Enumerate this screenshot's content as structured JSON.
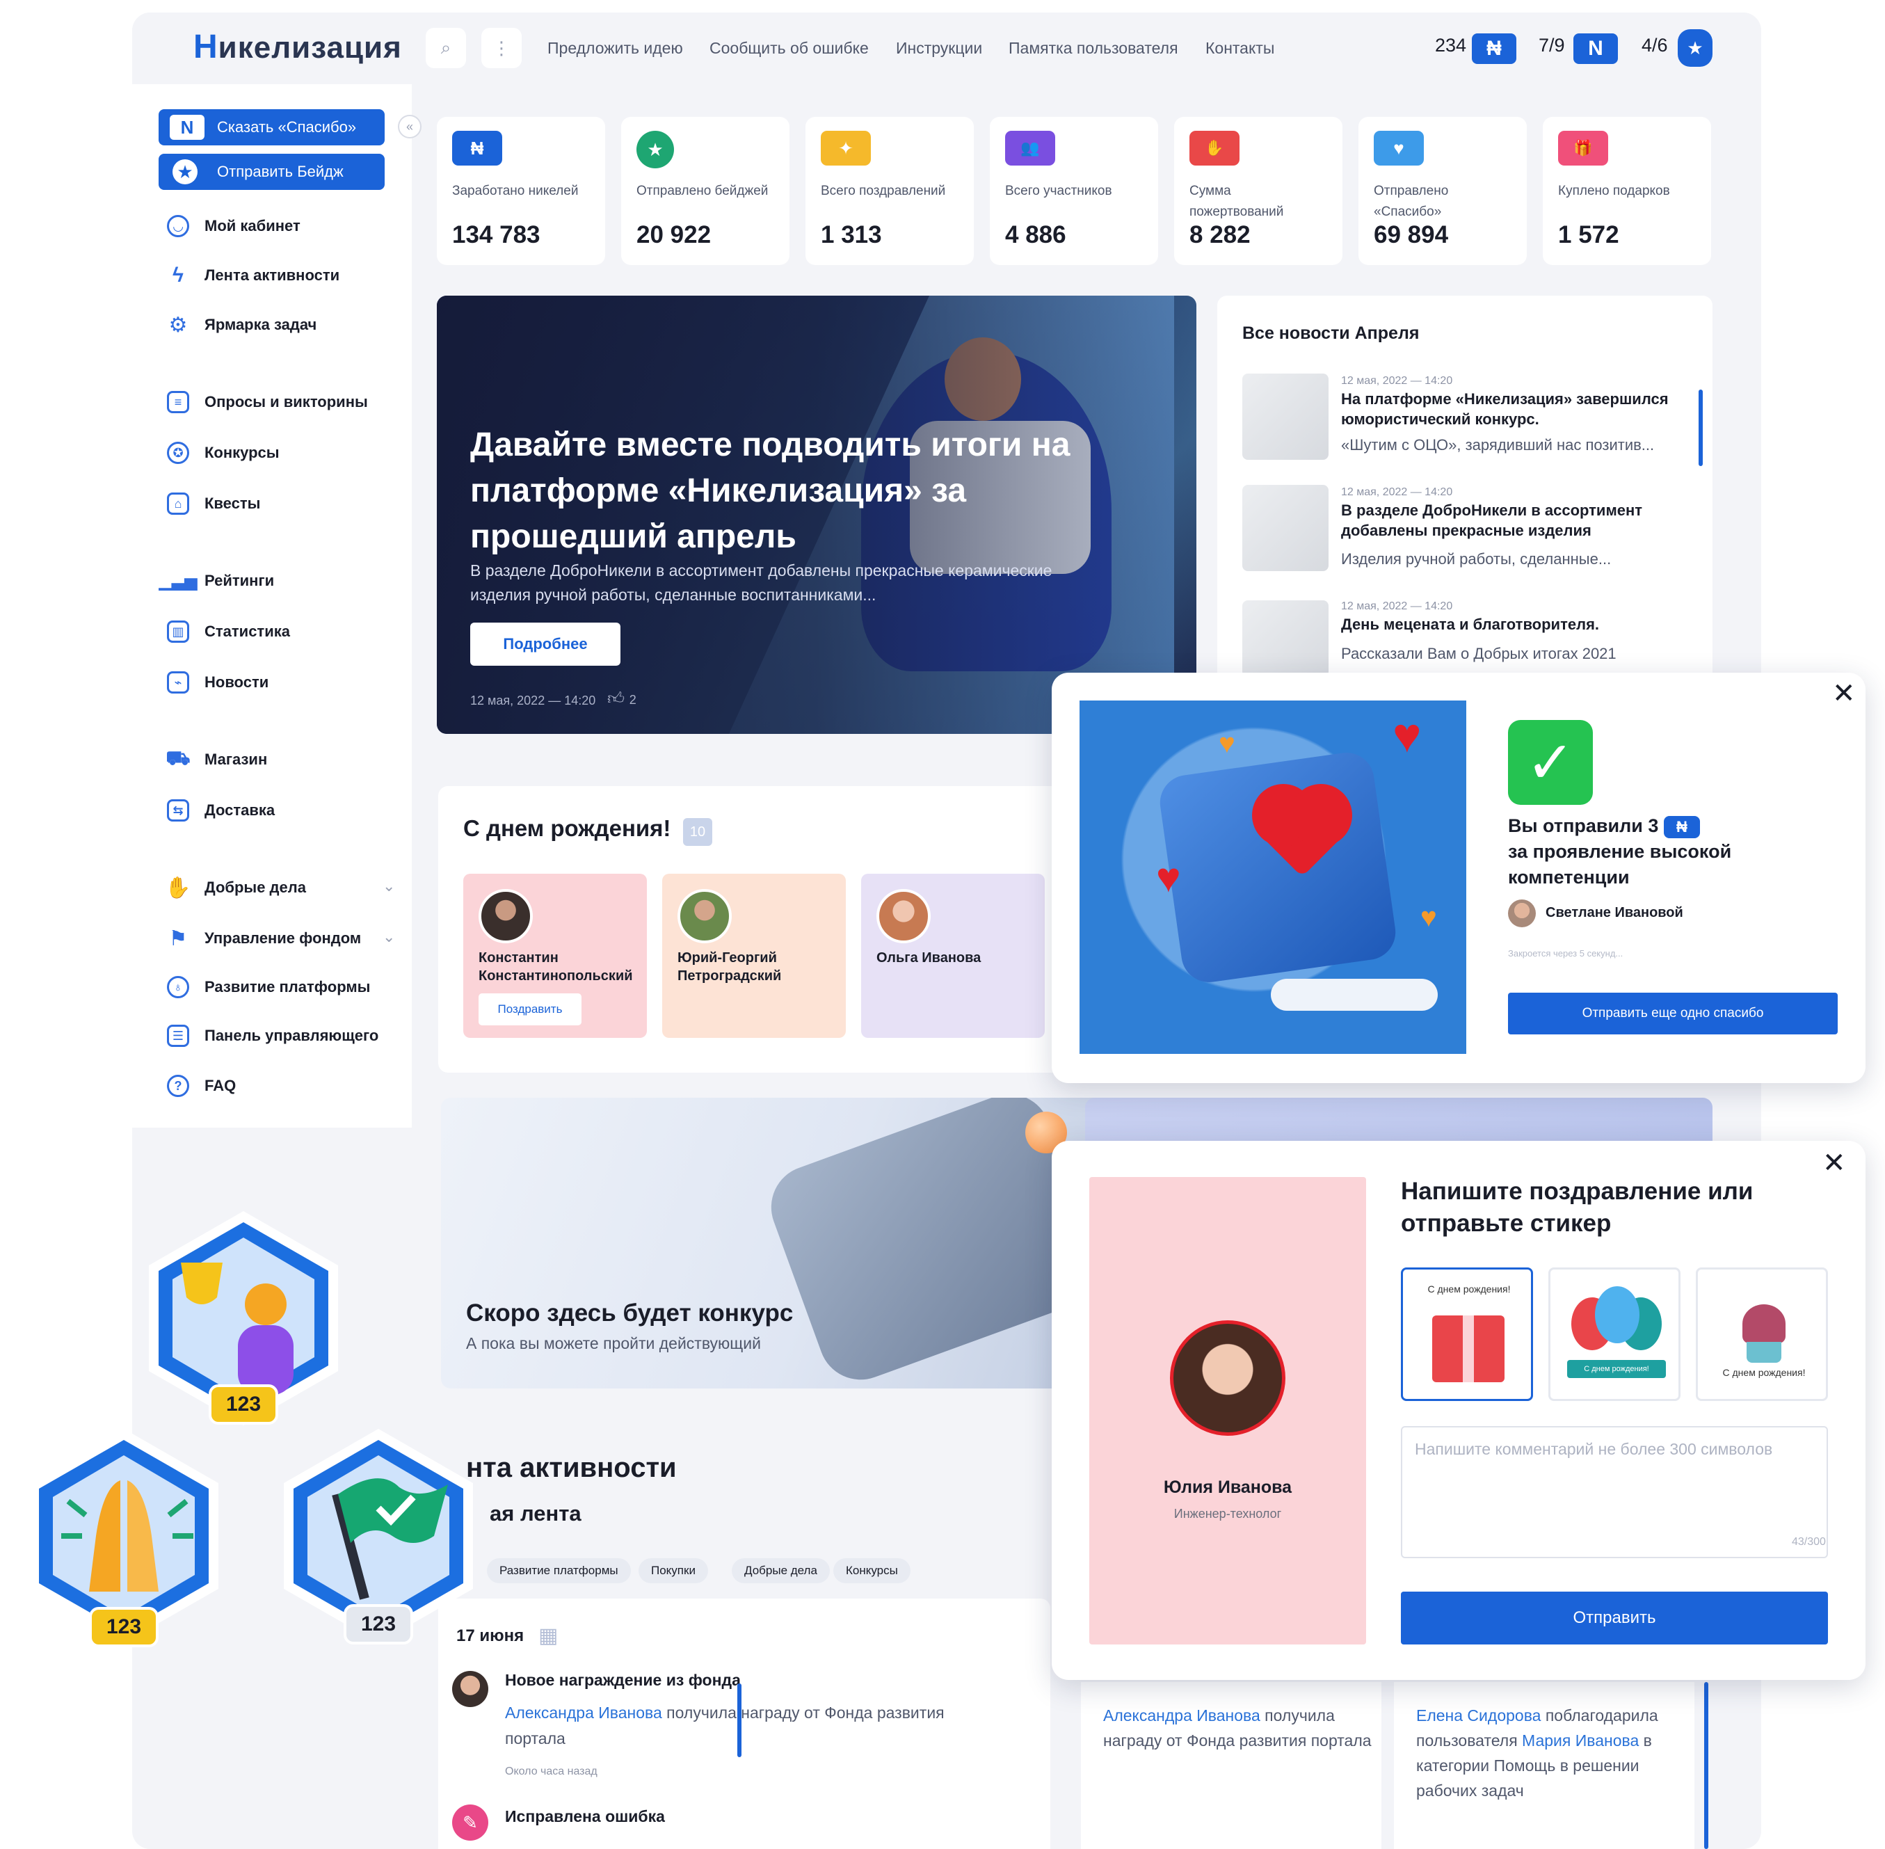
{
  "header": {
    "logo_first": "Н",
    "logo_rest": "икелизация",
    "nav": [
      "Предложить идею",
      "Сообщить об ошибке",
      "Инструкции",
      "Памятка пользователя",
      "Контакты"
    ],
    "counters": [
      {
        "value": "234",
        "icon": "nickel-icon"
      },
      {
        "value": "7/9",
        "icon": "nickel-heart-icon"
      },
      {
        "value": "4/6",
        "icon": "badge-star-icon"
      }
    ]
  },
  "sidebar": {
    "primary_buttons": [
      "Сказать «Спасибо»",
      "Отправить Бейдж"
    ],
    "items": [
      {
        "label": "Мой кабинет",
        "icon": "user-icon"
      },
      {
        "label": "Лента активности",
        "icon": "lightning-icon"
      },
      {
        "label": "Ярмарка задач",
        "icon": "gear-icon"
      },
      {
        "label": "Опросы и викторины",
        "icon": "poll-icon"
      },
      {
        "label": "Конкурсы",
        "icon": "award-icon"
      },
      {
        "label": "Квесты",
        "icon": "quest-icon"
      },
      {
        "label": "Рейтинги",
        "icon": "rating-icon"
      },
      {
        "label": "Статистика",
        "icon": "chart-icon"
      },
      {
        "label": "Новости",
        "icon": "news-icon"
      },
      {
        "label": "Магазин",
        "icon": "cart-icon"
      },
      {
        "label": "Доставка",
        "icon": "delivery-icon"
      },
      {
        "label": "Добрые дела",
        "icon": "hand-heart-icon"
      },
      {
        "label": "Управление фондом",
        "icon": "flag-icon"
      },
      {
        "label": "Развитие платформы",
        "icon": "bulb-icon"
      },
      {
        "label": "Панель управляющего",
        "icon": "panel-icon"
      },
      {
        "label": "FAQ",
        "icon": "question-icon"
      }
    ]
  },
  "stats": [
    {
      "label": "Заработано никелей",
      "value": "134 783",
      "color": "#1b63d8",
      "glyph": "₦"
    },
    {
      "label": "Отправлено бейджей",
      "value": "20 922",
      "color": "#1ea672",
      "glyph": "★"
    },
    {
      "label": "Всего поздравлений",
      "value": "1 313",
      "color": "#f5b92b",
      "glyph": "✦"
    },
    {
      "label": "Всего участников",
      "value": "4 886",
      "color": "#7a4fe0",
      "glyph": "👥"
    },
    {
      "label": "Сумма пожертвований",
      "value": "8 282",
      "color": "#e94848",
      "glyph": "✋"
    },
    {
      "label": "Отправлено «Спасибо»",
      "value": "69 894",
      "color": "#3d9be9",
      "glyph": "♥"
    },
    {
      "label": "Куплено подарков",
      "value": "1 572",
      "color": "#f0507a",
      "glyph": "🎁"
    }
  ],
  "hero": {
    "title": "Давайте вместе подводить итоги на платформе «Никелизация» за прошедший апрель",
    "subtitle": "В разделе ДоброНикели в ассортимент добавлены прекрасные керамические изделия ручной работы, сделанные воспитанниками...",
    "button": "Подробнее",
    "date": "12 мая, 2022 — 14:20",
    "likes": "2"
  },
  "news": {
    "title": "Все новости Апреля",
    "items": [
      {
        "date": "12 мая, 2022 — 14:20",
        "title": "На платформе «Никелизация» завершился юмористический конкурс.",
        "text": "«Шутим с ОЦО», зарядивший нас позитив..."
      },
      {
        "date": "12 мая, 2022 — 14:20",
        "title": "В разделе ДоброНикели в ассортимент добавлены прекрасные изделия",
        "text": "Изделия ручной работы, сделанные..."
      },
      {
        "date": "12 мая, 2022 — 14:20",
        "title": "День мецената и благотворителя.",
        "text": "Рассказали Вам о Добрых итогах 2021"
      }
    ]
  },
  "birthdays": {
    "title": "С днем рождения!",
    "count": "10",
    "people": [
      {
        "name": "Константин Константинопольский",
        "action": "Поздравить",
        "bg": "#fbd4d8"
      },
      {
        "name": "Юрий-Георгий Петроградский",
        "bg": "#fde3d5"
      },
      {
        "name": "Ольга Иванова",
        "bg": "#e7e1f6"
      }
    ]
  },
  "contest": {
    "title": "Скоро здесь будет конкурс",
    "subtitle": "А пока вы можете пройти действующий"
  },
  "activity": {
    "title_partial": "нта активности",
    "feed_partial": "ая лента",
    "chips": [
      "Развитие платформы",
      "Покупки",
      "Добрые дела",
      "Конкурсы"
    ],
    "date": "17 июня",
    "events": [
      {
        "title": "Новое награждение из фонда",
        "link": "Александра Иванова",
        "text": " получила награду от Фонда развития портала",
        "meta": "Около часа назад"
      },
      {
        "title": "Исправлена ошибка"
      }
    ],
    "columns": [
      {
        "link": "Александра Иванова",
        "text": " получила награду от Фонда развития портала"
      },
      {
        "link": "Елена Сидорова",
        "text": " поблагодарила пользователя ",
        "link2": "Мария Иванова",
        "text2": " в категории Помощь в решении рабочих задач"
      }
    ]
  },
  "thanks_popup": {
    "line1": "Вы отправили 3",
    "line2": "за проявление высокой компетенции",
    "recipient": "Светлане Ивановой",
    "hint": "Закроется через 5 секунд...",
    "button": "Отправить еще одно спасибо"
  },
  "congrats_popup": {
    "title": "Напишите поздравление или отправьте стикер",
    "name": "Юлия Иванова",
    "role": "Инженер-технолог",
    "placeholder": "Напишите комментарий не более 300 символов",
    "counter": "43/300",
    "button": "Отправить",
    "stickers": [
      "С днем рождения!",
      "С днем рождения!",
      "С днем рождения!"
    ]
  },
  "badges": [
    "123",
    "123",
    "123"
  ],
  "colors": {
    "accent": "#1b63d8",
    "success": "#25c351",
    "heart": "#e4202a"
  }
}
